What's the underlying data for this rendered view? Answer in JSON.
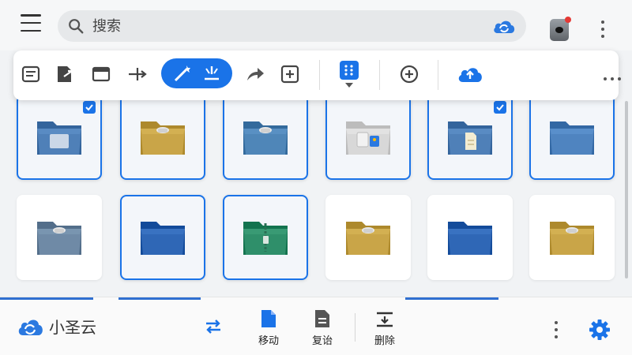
{
  "search": {
    "placeholder": "搜索"
  },
  "toolbar": {
    "items": [
      {
        "icon": "text-document-icon"
      },
      {
        "icon": "file-export-icon"
      },
      {
        "icon": "window-icon"
      },
      {
        "icon": "merge-arrow-icon"
      },
      {
        "icon": "magic-wand-icon",
        "active": true
      },
      {
        "icon": "beam-icon",
        "active": true
      },
      {
        "icon": "share-arrow-icon"
      },
      {
        "icon": "add-box-icon"
      },
      {
        "icon": "grid-view-icon"
      },
      {
        "icon": "add-circle-icon"
      },
      {
        "icon": "cloud-upload-icon"
      },
      {
        "icon": "more-horiz-icon"
      }
    ]
  },
  "folders": [
    {
      "color": "#4f80b8",
      "selected": true,
      "checked": true,
      "badge": "document"
    },
    {
      "color": "#c9a548",
      "selected": true,
      "checked": false,
      "badge": "clip"
    },
    {
      "color": "#4f86b8",
      "selected": true,
      "checked": false,
      "badge": "clip"
    },
    {
      "color": "#d8d8d8",
      "selected": true,
      "checked": false,
      "badge": "image"
    },
    {
      "color": "#4f80b8",
      "selected": true,
      "checked": true,
      "badge": "paper"
    },
    {
      "color": "#4f84c0",
      "selected": true,
      "checked": false,
      "badge": "none"
    },
    {
      "color": "#6f8aa6",
      "selected": false,
      "checked": false,
      "badge": "clip"
    },
    {
      "color": "#2f67b6",
      "selected": true,
      "checked": false,
      "badge": "none"
    },
    {
      "color": "#2f8f6a",
      "selected": true,
      "checked": false,
      "badge": "zip"
    },
    {
      "color": "#c9a548",
      "selected": false,
      "checked": false,
      "badge": "clip"
    },
    {
      "color": "#2f67b6",
      "selected": false,
      "checked": false,
      "badge": "none"
    },
    {
      "color": "#c9a548",
      "selected": false,
      "checked": false,
      "badge": "clip"
    }
  ],
  "bottom": {
    "app_name": "小圣云",
    "actions": [
      {
        "icon": "swap-icon",
        "label": ""
      },
      {
        "icon": "file-move-icon",
        "label": "移动"
      },
      {
        "icon": "file-copy-icon",
        "label": "复诒"
      },
      {
        "icon": "delete-icon",
        "label": "删除"
      }
    ]
  },
  "colors": {
    "accent": "#1a73e8",
    "background": "#f1f3f5",
    "gear": "#1a73e8"
  }
}
